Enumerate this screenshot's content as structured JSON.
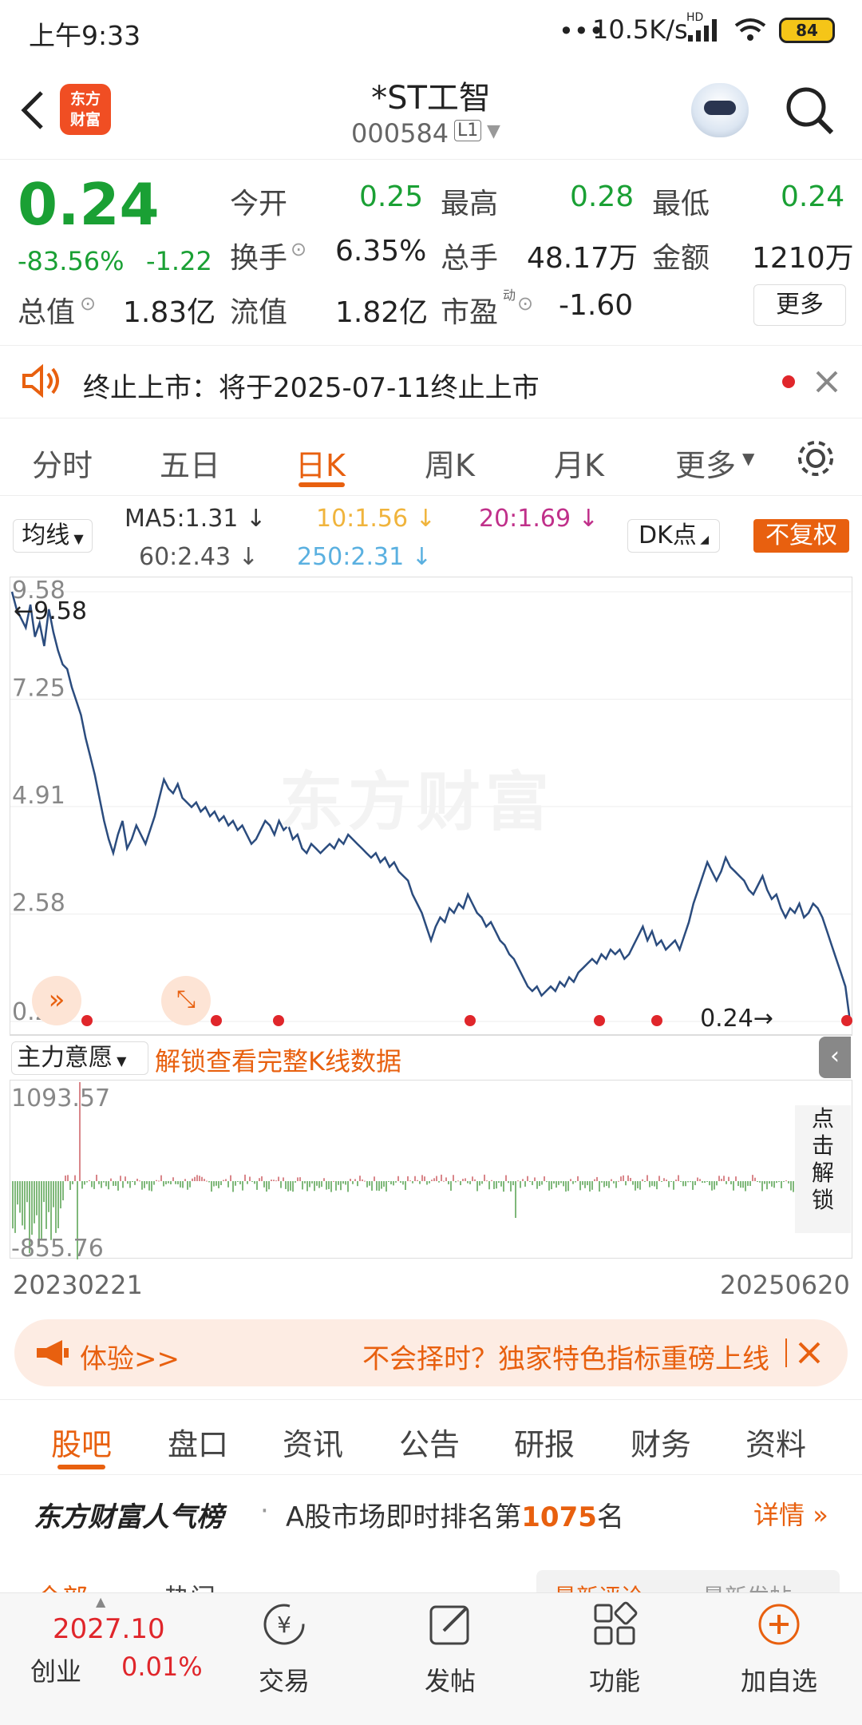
{
  "status": {
    "time": "上午9:33",
    "net": "10.5K/s",
    "hd": "HD",
    "battery": "84"
  },
  "nav": {
    "logo_line1": "东方",
    "logo_line2": "财富",
    "title": "*ST工智",
    "code": "000584",
    "level": "L1"
  },
  "quote": {
    "price": "0.24",
    "pct": "-83.56%",
    "chg": "-1.22",
    "open_label": "今开",
    "open": "0.25",
    "high_label": "最高",
    "high": "0.28",
    "low_label": "最低",
    "low": "0.24",
    "turnover_label": "换手",
    "turnover": "6.35%",
    "vol_label": "总手",
    "vol": "48.17万",
    "amount_label": "金额",
    "amount": "1210万",
    "mcap_label": "总值",
    "mcap": "1.83亿",
    "float_label": "流值",
    "float": "1.82亿",
    "pe_label": "市盈",
    "pe_sup": "动",
    "pe": "-1.60",
    "more": "更多"
  },
  "notice": {
    "text": "终止上市：将于2025-07-11终止上市"
  },
  "ktabs": [
    "分时",
    "五日",
    "日K",
    "周K",
    "月K",
    "更多"
  ],
  "ma": {
    "selector": "均线",
    "ma5": "MA5:1.31",
    "ma10": "10:1.56",
    "ma20": "20:1.69",
    "ma60": "60:2.43",
    "ma250": "250:2.31",
    "dk": "DK点",
    "fq": "不复权",
    "c5": "#333333",
    "c10": "#f0b43c",
    "c20": "#c0308a",
    "c60": "#555555",
    "c250": "#5ab0e0"
  },
  "chart_data": {
    "type": "line",
    "y_ticks": [
      "9.58",
      "7.25",
      "4.91",
      "2.58",
      "0.24"
    ],
    "ylim": [
      0.24,
      9.58
    ],
    "high_label": "9.58",
    "low_label": "0.24",
    "x_start": "20230221",
    "x_end": "20250620",
    "series": [
      {
        "color": "#2b4c7e",
        "values": [
          9.58,
          9.2,
          9.0,
          8.8,
          9.3,
          8.6,
          8.9,
          8.4,
          9.2,
          8.7,
          8.3,
          8.0,
          7.9,
          7.5,
          7.2,
          6.9,
          6.4,
          6.0,
          5.6,
          5.1,
          4.6,
          4.2,
          3.9,
          4.3,
          4.6,
          4.0,
          4.2,
          4.5,
          4.3,
          4.1,
          4.4,
          4.7,
          5.1,
          5.5,
          5.3,
          5.2,
          5.4,
          5.1,
          5.0,
          4.9,
          5.0,
          4.8,
          4.9,
          4.7,
          4.8,
          4.6,
          4.7,
          4.5,
          4.6,
          4.4,
          4.5,
          4.3,
          4.1,
          4.2,
          4.4,
          4.6,
          4.5,
          4.3,
          4.6,
          4.4,
          4.5,
          4.2,
          4.3,
          4.0,
          3.9,
          4.1,
          4.0,
          3.9,
          4.0,
          4.1,
          4.0,
          4.2,
          4.1,
          4.3,
          4.2,
          4.1,
          4.0,
          3.9,
          3.8,
          3.9,
          3.7,
          3.8,
          3.6,
          3.7,
          3.5,
          3.4,
          3.3,
          3.0,
          2.8,
          2.6,
          2.3,
          2.0,
          2.3,
          2.5,
          2.4,
          2.7,
          2.6,
          2.8,
          2.7,
          3.0,
          2.8,
          2.6,
          2.5,
          2.3,
          2.4,
          2.2,
          2.0,
          1.9,
          1.7,
          1.6,
          1.4,
          1.2,
          1.0,
          0.9,
          1.0,
          0.8,
          0.9,
          1.0,
          0.9,
          1.1,
          1.0,
          1.2,
          1.1,
          1.3,
          1.4,
          1.5,
          1.6,
          1.5,
          1.7,
          1.6,
          1.8,
          1.7,
          1.8,
          1.6,
          1.7,
          1.9,
          2.1,
          2.3,
          2.0,
          2.2,
          1.9,
          2.0,
          1.8,
          1.9,
          2.0,
          1.8,
          2.1,
          2.4,
          2.8,
          3.1,
          3.4,
          3.7,
          3.5,
          3.3,
          3.5,
          3.8,
          3.6,
          3.5,
          3.4,
          3.3,
          3.1,
          3.0,
          3.2,
          3.4,
          3.1,
          2.9,
          3.0,
          2.7,
          2.5,
          2.7,
          2.6,
          2.8,
          2.5,
          2.6,
          2.8,
          2.7,
          2.5,
          2.2,
          1.9,
          1.6,
          1.3,
          1.0,
          0.24
        ]
      }
    ]
  },
  "chart_ui": {
    "arrow_hi": "←9.58",
    "arrow_lo": "0.24→",
    "ind_selector": "主力意愿",
    "unlock": "解锁查看完整K线数据",
    "vol_top": "1093.57",
    "vol_bot": "-855.76",
    "side_unlock": [
      "点",
      "击",
      "解",
      "锁"
    ]
  },
  "banner": {
    "left": "体验>>",
    "right": "不会择时？独家特色指标重磅上线"
  },
  "section_tabs": [
    "股吧",
    "盘口",
    "资讯",
    "公告",
    "研报",
    "财务",
    "资料"
  ],
  "rank": {
    "brand": "东方财富人气榜",
    "dot": "·",
    "text_a": "A股市场即时排名第",
    "rank": "1075",
    "text_b": "名",
    "detail": "详情"
  },
  "partial": {
    "a": "全部",
    "b": "热门",
    "c": "最新评论",
    "d": "最新发帖"
  },
  "bottom": {
    "index_val": "2027.10",
    "index_name": "创业",
    "index_pct": "0.01%",
    "trade": "交易",
    "post": "发帖",
    "func": "功能",
    "add": "加自选"
  }
}
